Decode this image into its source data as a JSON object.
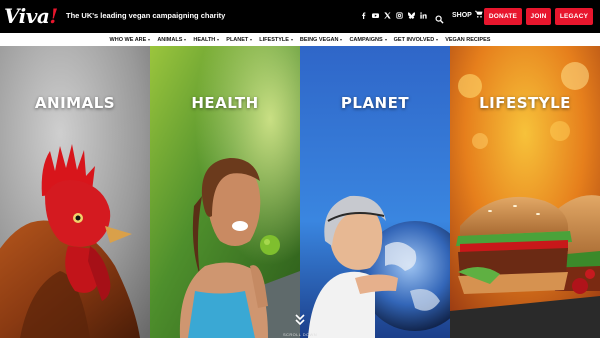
{
  "header": {
    "logo_text": "Viva",
    "logo_mark": "!",
    "tagline": "The UK's leading vegan campaigning charity",
    "social_icons": [
      "facebook-icon",
      "youtube-icon",
      "x-icon",
      "instagram-icon",
      "bluesky-icon",
      "linkedin-icon"
    ],
    "shop_label": "SHOP",
    "donate_label": "DONATE",
    "join_label": "JOIN",
    "legacy_label": "LEGACY",
    "accent_color": "#e8162d"
  },
  "nav": {
    "items": [
      {
        "label": "WHO WE ARE",
        "dropdown": true
      },
      {
        "label": "ANIMALS",
        "dropdown": true
      },
      {
        "label": "HEALTH",
        "dropdown": true
      },
      {
        "label": "PLANET",
        "dropdown": true
      },
      {
        "label": "LIFESTYLE",
        "dropdown": true
      },
      {
        "label": "BEING VEGAN",
        "dropdown": true
      },
      {
        "label": "CAMPAIGNS",
        "dropdown": true
      },
      {
        "label": "GET INVOLVED",
        "dropdown": true
      },
      {
        "label": "VEGAN RECIPES",
        "dropdown": false
      }
    ]
  },
  "panels": [
    {
      "title": "ANIMALS"
    },
    {
      "title": "HEALTH"
    },
    {
      "title": "PLANET"
    },
    {
      "title": "LIFESTYLE"
    }
  ],
  "scroll_label": "SCROLL DOWN"
}
